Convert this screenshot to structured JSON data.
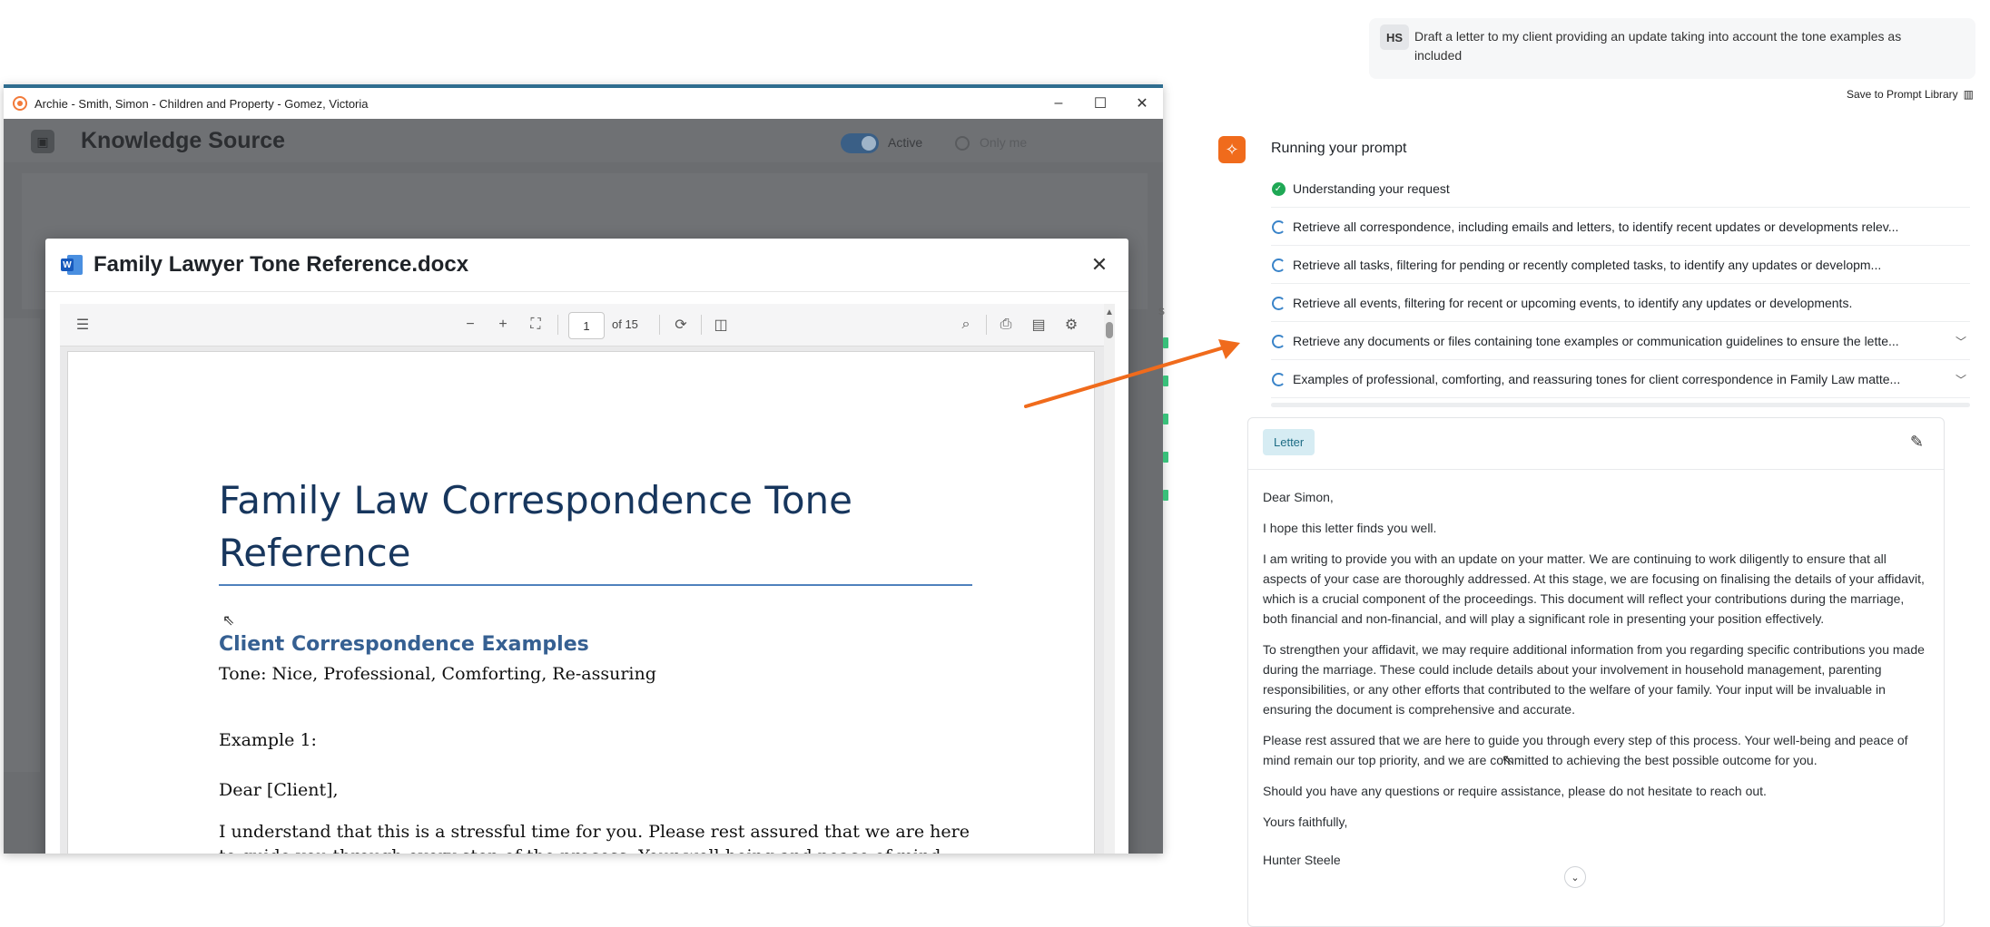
{
  "app_window": {
    "title": "Archie - Smith, Simon - Children and Property - Gomez, Victoria",
    "controls": {
      "minimize": "–",
      "maximize": "☐",
      "close": "✕"
    },
    "background": {
      "section_title": "Knowledge Source",
      "active_label": "Active",
      "only_me_label": "Only me"
    }
  },
  "dialog": {
    "title": "Family Lawyer Tone Reference.docx",
    "close": "✕",
    "toolbar": {
      "page_value": "1",
      "page_total": "of 15"
    },
    "document": {
      "heading": "Family Law Correspondence Tone Reference",
      "subheading": "Client Correspondence Examples",
      "tone_line": "Tone: Nice, Professional, Comforting, Re-assuring",
      "example_label": "Example 1:",
      "salutation": "Dear [Client],",
      "paragraph": "I understand that this is a stressful time for you. Please rest assured that we are here to guide you through every step of the process. Your well-being and peace of mind are our top priority. We will handle the legal matters so that you can focus on looking after yourself and"
    }
  },
  "chat": {
    "user_initials": "HS",
    "user_message": "Draft a letter to my client providing an update taking into account the tone examples as included",
    "save_prompt": "Save to Prompt Library",
    "running_title": "Running your prompt",
    "steps": [
      {
        "label": "Understanding your request",
        "status": "done"
      },
      {
        "label": "Retrieve all correspondence, including emails and letters, to identify recent updates or developments relev...",
        "status": "running"
      },
      {
        "label": "Retrieve all tasks, filtering for pending or recently completed tasks, to identify any updates or developm...",
        "status": "running"
      },
      {
        "label": "Retrieve all events, filtering for recent or upcoming events, to identify any updates or developments.",
        "status": "running"
      },
      {
        "label": "Retrieve any documents or files containing tone examples or communication guidelines to ensure the lette...",
        "status": "running",
        "expandable": true
      },
      {
        "label": "Examples of professional, comforting, and reassuring tones for client correspondence in Family Law matte...",
        "status": "running",
        "expandable": true
      }
    ],
    "letter": {
      "chip": "Letter",
      "paragraphs": [
        "Dear Simon,",
        "I hope this letter finds you well.",
        "I am writing to provide you with an update on your matter. We are continuing to work diligently to ensure that all aspects of your case are thoroughly addressed. At this stage, we are focusing on finalising the details of your affidavit, which is a crucial component of the proceedings. This document will reflect your contributions during the marriage, both financial and non-financial, and will play a significant role in presenting your position effectively.",
        "To strengthen your affidavit, we may require additional information from you regarding specific contributions you made during the marriage. These could include details about your involvement in household management, parenting responsibilities, or any other efforts that contributed to the welfare of your family. Your input will be invaluable in ensuring the document is comprehensive and accurate.",
        "Please rest assured that we are here to guide you through every step of this process. Your well-being and peace of mind remain our top priority, and we are committed to achieving the best possible outcome for you.",
        "Should you have any questions or require assistance, please do not hesitate to reach out.",
        "Yours faithfully,",
        "Hunter Steele"
      ]
    }
  },
  "colors": {
    "accent_orange": "#f06b1c",
    "success_green": "#1fa855",
    "heading_blue": "#17365d",
    "chip_bg": "#d6ecf3"
  }
}
